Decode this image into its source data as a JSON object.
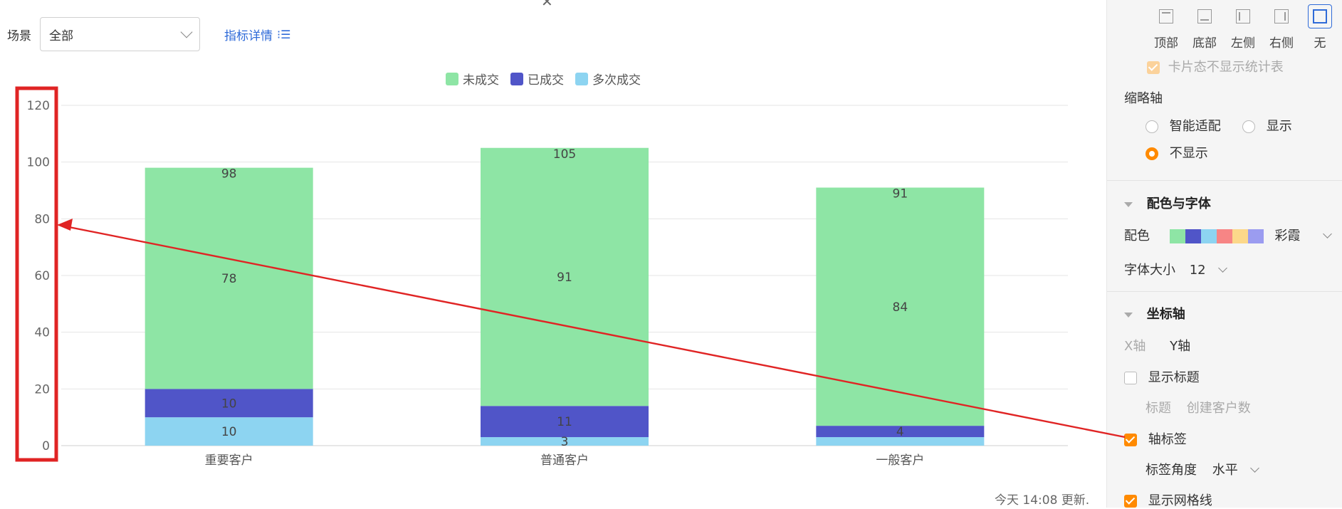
{
  "toolbar": {
    "scene_label": "场景",
    "scene_value": "全部",
    "detail_link": "指标详情",
    "detail_icon": "list-icon"
  },
  "legend": [
    {
      "name": "未成交",
      "color": "#8ee5a5"
    },
    {
      "name": "已成交",
      "color": "#5055c8"
    },
    {
      "name": "多次成交",
      "color": "#8dd4f1"
    }
  ],
  "chart_data": {
    "type": "bar",
    "stacked": true,
    "categories": [
      "重要客户",
      "普通客户",
      "一般客户"
    ],
    "series": [
      {
        "name": "多次成交",
        "color": "#8dd4f1",
        "values": [
          10,
          3,
          3
        ]
      },
      {
        "name": "已成交",
        "color": "#5055c8",
        "values": [
          10,
          11,
          4
        ]
      },
      {
        "name": "未成交",
        "color": "#8ee5a5",
        "values": [
          78,
          91,
          84
        ]
      }
    ],
    "totals": [
      98,
      105,
      91
    ],
    "data_labels": [
      {
        "category": "重要客户",
        "multi": "10",
        "done": "10",
        "undone": "78",
        "total": "98"
      },
      {
        "category": "普通客户",
        "multi": "3",
        "done": "11",
        "undone": "91",
        "total": "105"
      },
      {
        "category": "一般客户",
        "multi": "",
        "done": "4",
        "undone": "84",
        "total": "91"
      }
    ],
    "ylim": [
      0,
      120
    ],
    "yticks": [
      "0",
      "20",
      "40",
      "60",
      "80",
      "100",
      "120"
    ],
    "grid": true,
    "legend_position": "top-center"
  },
  "annotation": {
    "color": "#e02424",
    "note": "red box highlights y-axis labels; arrow points from 轴标签 to axis"
  },
  "update_text": "今天 14:08 更新.",
  "panel": {
    "positions": [
      {
        "label": "顶部",
        "icon": "legend-top-icon",
        "active": false
      },
      {
        "label": "底部",
        "icon": "legend-bottom-icon",
        "active": false
      },
      {
        "label": "左侧",
        "icon": "legend-left-icon",
        "active": false
      },
      {
        "label": "右侧",
        "icon": "legend-right-icon",
        "active": false
      },
      {
        "label": "无",
        "icon": "legend-none-icon",
        "active": true
      }
    ],
    "card_hide_stats": "卡片态不显示统计表",
    "thumb_axis_title": "缩略轴",
    "thumb_options": [
      "智能适配",
      "显示",
      "不显示"
    ],
    "thumb_selected": "不显示",
    "color_font_title": "配色与字体",
    "color_label": "配色",
    "palette_name": "彩霞",
    "palette_colors": [
      "#8ee5a5",
      "#5055c8",
      "#8dd4f1",
      "#f78585",
      "#fcd88a",
      "#9b9cf0"
    ],
    "font_size_label": "字体大小",
    "font_size_value": "12",
    "axis_title": "坐标轴",
    "axis_tabs": [
      "X轴",
      "Y轴"
    ],
    "show_title": "显示标题",
    "title_label": "标题",
    "title_value": "创建客户数",
    "axis_label": "轴标签",
    "label_angle_label": "标签角度",
    "label_angle_value": "水平",
    "show_grid": "显示网格线"
  }
}
